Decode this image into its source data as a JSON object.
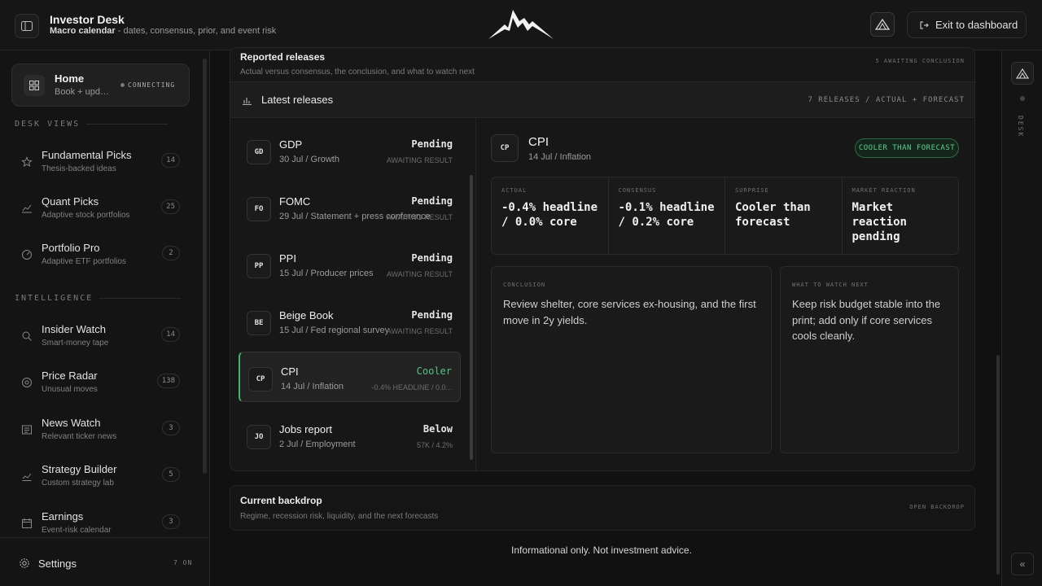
{
  "header": {
    "title": "Investor Desk",
    "subtitle_bold": "Macro calendar",
    "subtitle_rest": " - dates, consensus, prior, and event risk",
    "exit_label": "Exit to dashboard"
  },
  "sidebar": {
    "home": {
      "title": "Home",
      "subtitle": "Book + upd…",
      "status": "CONNECTING"
    },
    "sections": {
      "desk_views": "DESK VIEWS",
      "intelligence": "INTELLIGENCE"
    },
    "items": [
      {
        "title": "Fundamental Picks",
        "subtitle": "Thesis-backed ideas",
        "count": "14",
        "icon": "star-icon"
      },
      {
        "title": "Quant Picks",
        "subtitle": "Adaptive stock portfolios",
        "count": "25",
        "icon": "trend-icon"
      },
      {
        "title": "Portfolio Pro",
        "subtitle": "Adaptive ETF portfolios",
        "count": "2",
        "icon": "gauge-icon"
      },
      {
        "title": "Insider Watch",
        "subtitle": "Smart-money tape",
        "count": "14",
        "icon": "magnifier-icon"
      },
      {
        "title": "Price Radar",
        "subtitle": "Unusual moves",
        "count": "138",
        "icon": "radar-icon"
      },
      {
        "title": "News Watch",
        "subtitle": "Relevant ticker news",
        "count": "3",
        "icon": "newspaper-icon"
      },
      {
        "title": "Strategy Builder",
        "subtitle": "Custom strategy lab",
        "count": "5",
        "icon": "chart-icon"
      },
      {
        "title": "Earnings",
        "subtitle": "Event-risk calendar",
        "count": "3",
        "icon": "calendar-icon"
      }
    ],
    "settings": {
      "label": "Settings",
      "count": "7 ON"
    }
  },
  "main": {
    "reported": {
      "title": "Reported releases",
      "subtitle": "Actual versus consensus, the conclusion, and what to watch next",
      "right": "5 AWAITING CONCLUSION"
    },
    "latest": {
      "title": "Latest releases",
      "right": "7 RELEASES / ACTUAL + FORECAST"
    },
    "releases": [
      {
        "badge": "GD",
        "name": "GDP",
        "date": "30 Jul / Growth",
        "status": "Pending",
        "note": "AWAITING RESULT"
      },
      {
        "badge": "FO",
        "name": "FOMC",
        "date": "29 Jul / Statement + press conference",
        "status": "Pending",
        "note": "AWAITING RESULT"
      },
      {
        "badge": "PP",
        "name": "PPI",
        "date": "15 Jul / Producer prices",
        "status": "Pending",
        "note": "AWAITING RESULT"
      },
      {
        "badge": "BE",
        "name": "Beige Book",
        "date": "15 Jul / Fed regional survey",
        "status": "Pending",
        "note": "AWAITING RESULT"
      },
      {
        "badge": "CP",
        "name": "CPI",
        "date": "14 Jul / Inflation",
        "status": "Cooler",
        "note": "-0.4% HEADLINE / 0.0..."
      },
      {
        "badge": "JO",
        "name": "Jobs report",
        "date": "2 Jul / Employment",
        "status": "Below",
        "note": "57K / 4.2%"
      }
    ],
    "detail": {
      "badge": "CP",
      "name": "CPI",
      "date": "14 Jul / Inflation",
      "pill": "COOLER THAN FORECAST",
      "metrics": [
        {
          "label": "ACTUAL",
          "value": "-0.4% headline / 0.0% core"
        },
        {
          "label": "CONSENSUS",
          "value": "-0.1% headline / 0.2% core"
        },
        {
          "label": "SURPRISE",
          "value": "Cooler than forecast"
        },
        {
          "label": "MARKET REACTION",
          "value": "Market reaction pending"
        }
      ],
      "conclusion": {
        "label": "CONCLUSION",
        "text": "Review shelter, core services ex-housing, and the first move in 2y yields."
      },
      "watch_next": {
        "label": "WHAT TO WATCH NEXT",
        "text": "Keep risk budget stable into the print; add only if core services cools cleanly."
      }
    },
    "backdrop": {
      "title": "Current backdrop",
      "subtitle": "Regime, recession risk, liquidity, and the next forecasts",
      "link": "OPEN BACKDROP"
    },
    "disclaimer": "Informational only. Not investment advice."
  },
  "rail": {
    "label": "DESK",
    "collapse": "«"
  },
  "colors": {
    "accent_green": "#56c281",
    "background": "#121212"
  }
}
